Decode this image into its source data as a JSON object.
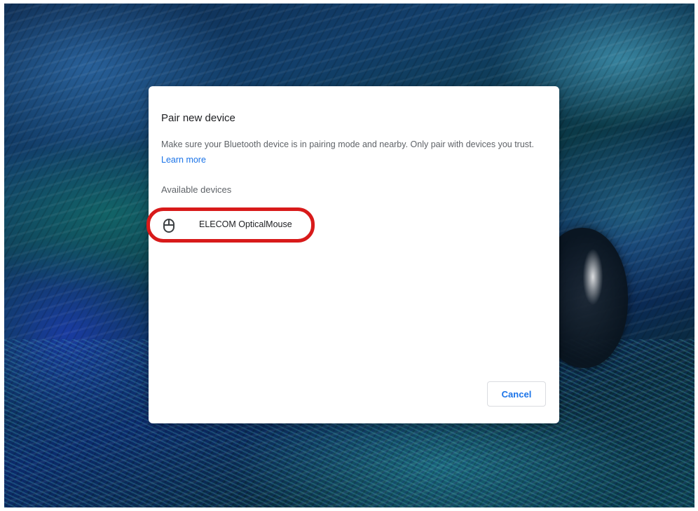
{
  "dialog": {
    "title": "Pair new device",
    "description": "Make sure your Bluetooth device is in pairing mode and nearby. Only pair with devices you trust.",
    "learn_more": "Learn more",
    "section_label": "Available devices",
    "devices": [
      {
        "name": "ELECOM OpticalMouse",
        "icon": "mouse-icon"
      }
    ],
    "cancel_label": "Cancel"
  },
  "annotation": {
    "highlight_color": "#d81a1a"
  },
  "colors": {
    "accent": "#1a73e8",
    "title_text": "#202124",
    "secondary_text": "#5f6368"
  }
}
